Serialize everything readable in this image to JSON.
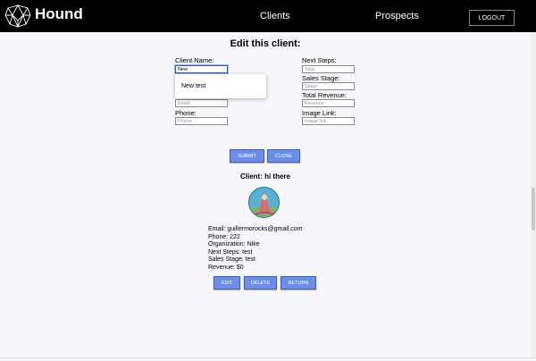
{
  "header": {
    "brand": "Hound",
    "nav": {
      "clients": "Clients",
      "prospects": "Prospects"
    },
    "logout_label": "LOGOUT"
  },
  "form": {
    "title": "Edit this client:",
    "client_name": {
      "label": "Client Name:",
      "value": "New"
    },
    "email": {
      "placeholder": "Email"
    },
    "phone": {
      "label": "Phone:",
      "placeholder": "Phone"
    },
    "next_steps": {
      "label": "Next Steps:",
      "placeholder": "Step"
    },
    "sales_stage": {
      "label": "Sales Stage:",
      "placeholder": "Stage"
    },
    "total_revenue": {
      "label": "Total Revenue:",
      "placeholder": "Revenue"
    },
    "image_link": {
      "label": "Image Link:",
      "placeholder": "image link"
    },
    "autocomplete_suggestion": "New test",
    "submit_label": "SUBMIT",
    "close_label": "CLOSE"
  },
  "client": {
    "title": "Client: hi there",
    "email_line": "Email: guillermorocks@gmail.com",
    "phone_line": "Phone: 222",
    "organization_line": "Organization: Nike",
    "next_steps_line": "Next Steps: test",
    "sales_stage_line": "Sales Stage: test",
    "revenue_line": "Revenue: $0",
    "edit_label": "EDIT",
    "delete_label": "DELETE",
    "return_label": "RETURN"
  },
  "colors": {
    "accent": "#6c8ee6",
    "header_bg": "#000000",
    "page_bg": "#f7f7fb"
  }
}
